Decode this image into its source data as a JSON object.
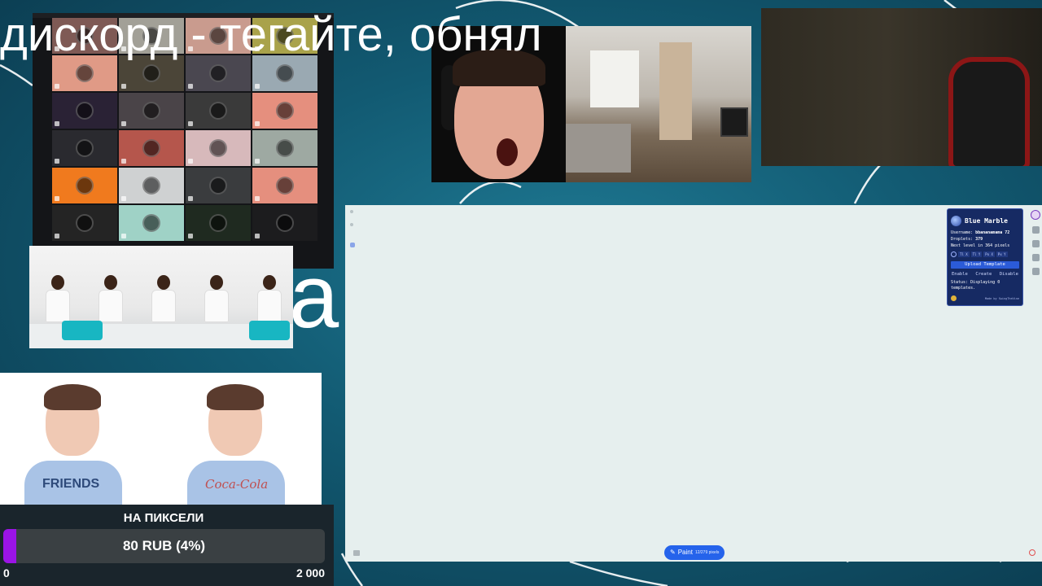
{
  "overlay": {
    "title": "дискорд  - тегайте, обнял",
    "ghost_letter": "а"
  },
  "donation": {
    "title": "НА ПИКСЕЛИ",
    "amount_text": "80 RUB (4%)",
    "progress_percent": 4,
    "min_label": "0",
    "max_label": "2 000",
    "fill_color": "#9b14e6"
  },
  "portraits": {
    "left_shirt": "FRIENDS",
    "right_shirt": "Coca-Cola"
  },
  "canvas": {
    "paint_label": "Paint",
    "paint_count": "12/279 pixels"
  },
  "blue_marble": {
    "title": "Blue Marble",
    "username_label": "Username:",
    "username": "bbananamama 72",
    "droplets_label": "Droplets:",
    "droplets": "379",
    "next_level": "Next level in 364 pixels",
    "coords": [
      "Tl X",
      "Tl Y",
      "Px X",
      "Px Y"
    ],
    "upload_label": "Upload Template",
    "actions": [
      "Enable",
      "Create",
      "Disable"
    ],
    "status": "Status: Displaying 0 templates.",
    "footer": "Made by SwingTheVine"
  },
  "discord_tile_colors": [
    "#7f5a55",
    "#a2a097",
    "#c99b8e",
    "#a9a24a",
    "#e09a86",
    "#4b4538",
    "#4a4750",
    "#9aa9b2",
    "#2a2235",
    "#4a4448",
    "#3a3a3a",
    "#e58f7e",
    "#2a2a2f",
    "#b5564c",
    "#d7b9bb",
    "#9ea9a2",
    "#f07a1e",
    "#cfd1d2",
    "#3a3c3e",
    "#e58f7e",
    "#242424",
    "#9fd2c6",
    "#1f2a20",
    "#1c1c1e"
  ]
}
